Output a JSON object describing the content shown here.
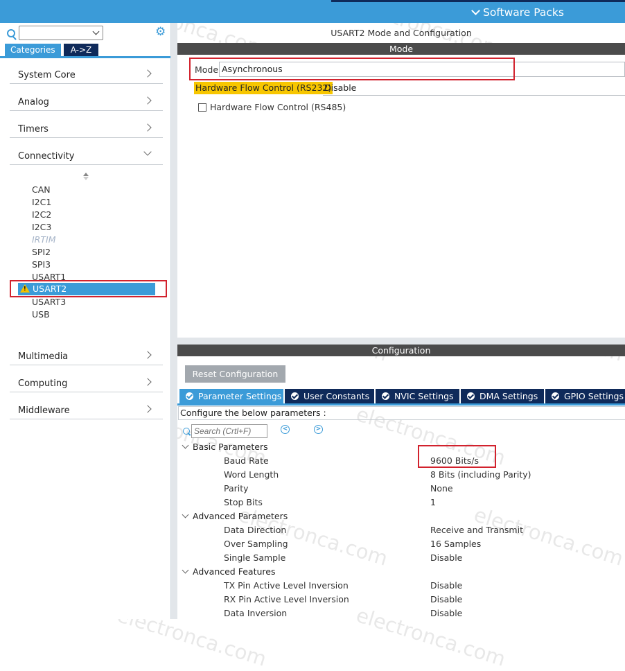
{
  "header": {
    "software_packs_label": "Software Packs"
  },
  "left_panel": {
    "search_value": "",
    "tabs": {
      "categories": "Categories",
      "az": "A->Z"
    },
    "categories": [
      {
        "label": "System Core"
      },
      {
        "label": "Analog"
      },
      {
        "label": "Timers"
      },
      {
        "label": "Connectivity"
      },
      {
        "label": "Multimedia"
      },
      {
        "label": "Computing"
      },
      {
        "label": "Middleware"
      }
    ],
    "peripherals": [
      "CAN",
      "I2C1",
      "I2C2",
      "I2C3",
      "IRTIM",
      "SPI2",
      "SPI3",
      "USART1",
      "USART2",
      "USART3",
      "USB"
    ],
    "selected_peripheral": "USART2",
    "disabled_peripheral": "IRTIM"
  },
  "config": {
    "title": "USART2 Mode and Configuration",
    "mode_section": "Mode",
    "mode_label": "Mode",
    "mode_value": "Asynchronous",
    "hfc232_label": "Hardware Flow Control (RS232)",
    "hfc232_value": "Disable",
    "hfc485_label": "Hardware Flow Control (RS485)",
    "configuration_section": "Configuration",
    "reset_button": "Reset Configuration",
    "tabs": [
      "Parameter Settings",
      "User Constants",
      "NVIC Settings",
      "DMA Settings",
      "GPIO Settings"
    ],
    "configure_text": "Configure the below parameters :",
    "search_placeholder": "Search (Crtl+F)",
    "groups": [
      {
        "name": "Basic Parameters",
        "params": [
          {
            "name": "Baud Rate",
            "value": "9600 Bits/s"
          },
          {
            "name": "Word Length",
            "value": "8 Bits (including Parity)"
          },
          {
            "name": "Parity",
            "value": "None"
          },
          {
            "name": "Stop Bits",
            "value": "1"
          }
        ]
      },
      {
        "name": "Advanced Parameters",
        "params": [
          {
            "name": "Data Direction",
            "value": "Receive and Transmit"
          },
          {
            "name": "Over Sampling",
            "value": "16 Samples"
          },
          {
            "name": "Single Sample",
            "value": "Disable"
          }
        ]
      },
      {
        "name": "Advanced Features",
        "params": [
          {
            "name": "TX Pin Active Level Inversion",
            "value": "Disable"
          },
          {
            "name": "RX Pin Active Level Inversion",
            "value": "Disable"
          },
          {
            "name": "Data Inversion",
            "value": "Disable"
          }
        ]
      }
    ]
  },
  "watermark": "electronca.com",
  "colors": {
    "accent": "#3b9bd8",
    "dark_tab": "#0f2a5a",
    "highlight": "#f7c600",
    "annotation": "#d2222d"
  }
}
